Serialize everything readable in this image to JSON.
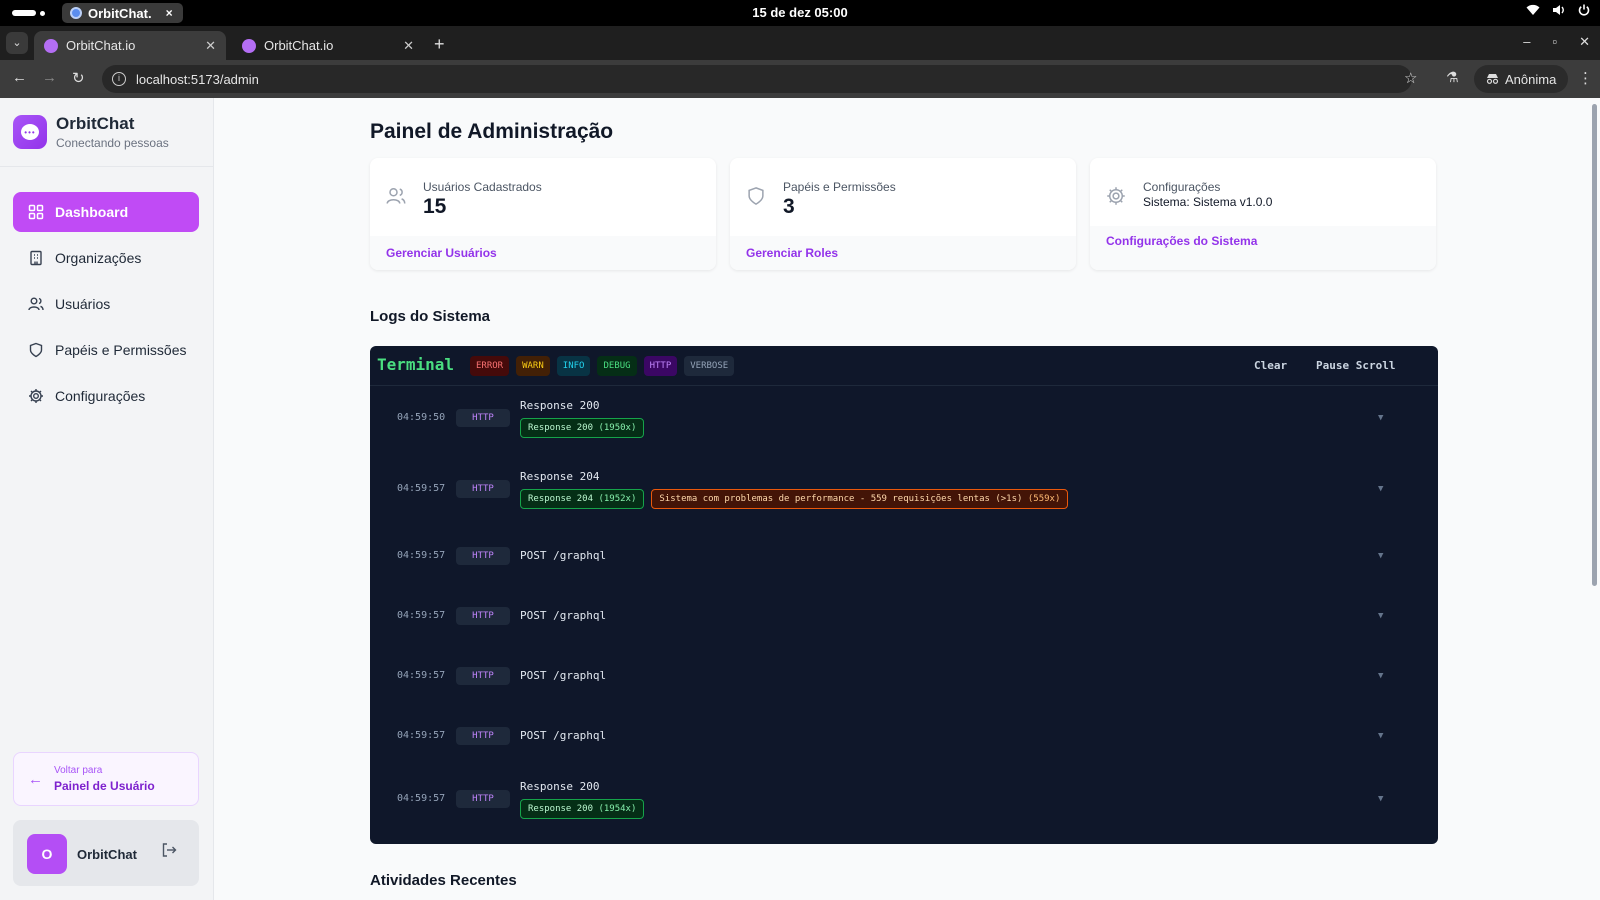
{
  "os": {
    "app_name": "OrbitChat.",
    "clock": "15 de dez  05:00"
  },
  "browser": {
    "tabs": [
      {
        "title": "OrbitChat.io"
      },
      {
        "title": "OrbitChat.io"
      }
    ],
    "url": "localhost:5173/admin",
    "profile_label": "Anônima"
  },
  "sidebar": {
    "brand_name": "OrbitChat",
    "brand_tagline": "Conectando pessoas",
    "items": [
      {
        "label": "Dashboard",
        "icon": "grid-icon",
        "active": true
      },
      {
        "label": "Organizações",
        "icon": "building-icon",
        "active": false
      },
      {
        "label": "Usuários",
        "icon": "users-icon",
        "active": false
      },
      {
        "label": "Papéis e Permissões",
        "icon": "shield-icon",
        "active": false
      },
      {
        "label": "Configurações",
        "icon": "gear-icon",
        "active": false
      }
    ],
    "back_line1": "Voltar para",
    "back_line2": "Painel de Usuário",
    "user_initial": "O",
    "user_name": "OrbitChat"
  },
  "main": {
    "page_title": "Painel de Administração",
    "cards": [
      {
        "label": "Usuários Cadastrados",
        "value": "15",
        "link": "Gerenciar Usuários",
        "icon": "users-icon"
      },
      {
        "label": "Papéis e Permissões",
        "value": "3",
        "link": "Gerenciar Roles",
        "icon": "shield-icon"
      },
      {
        "label": "Configurações",
        "value": "Sistema: Sistema v1.0.0",
        "link": "Configurações do Sistema",
        "icon": "gear-icon"
      }
    ],
    "logs_title": "Logs do Sistema",
    "recent_title": "Atividades Recentes"
  },
  "terminal": {
    "title": "Terminal",
    "filters": [
      "ERROR",
      "WARN",
      "INFO",
      "DEBUG",
      "HTTP",
      "VERBOSE"
    ],
    "clear_label": "Clear",
    "pause_label": "Pause Scroll",
    "logs": [
      {
        "time": "04:59:50",
        "level": "HTTP",
        "message": "Response 200",
        "badges": [
          {
            "text": "Response 200",
            "count": "(1950x)",
            "kind": "ok"
          }
        ]
      },
      {
        "time": "04:59:57",
        "level": "HTTP",
        "message": "Response 204",
        "badges": [
          {
            "text": "Response 204",
            "count": "(1952x)",
            "kind": "ok"
          },
          {
            "text": "Sistema com problemas de performance - 559 requisições lentas (>1s)",
            "count": "(559x)",
            "kind": "warn"
          }
        ]
      },
      {
        "time": "04:59:57",
        "level": "HTTP",
        "message": "POST /graphql",
        "badges": []
      },
      {
        "time": "04:59:57",
        "level": "HTTP",
        "message": "POST /graphql",
        "badges": []
      },
      {
        "time": "04:59:57",
        "level": "HTTP",
        "message": "POST /graphql",
        "badges": []
      },
      {
        "time": "04:59:57",
        "level": "HTTP",
        "message": "POST /graphql",
        "badges": []
      },
      {
        "time": "04:59:57",
        "level": "HTTP",
        "message": "Response 200",
        "badges": [
          {
            "text": "Response 200",
            "count": "(1954x)",
            "kind": "ok"
          }
        ]
      }
    ]
  }
}
